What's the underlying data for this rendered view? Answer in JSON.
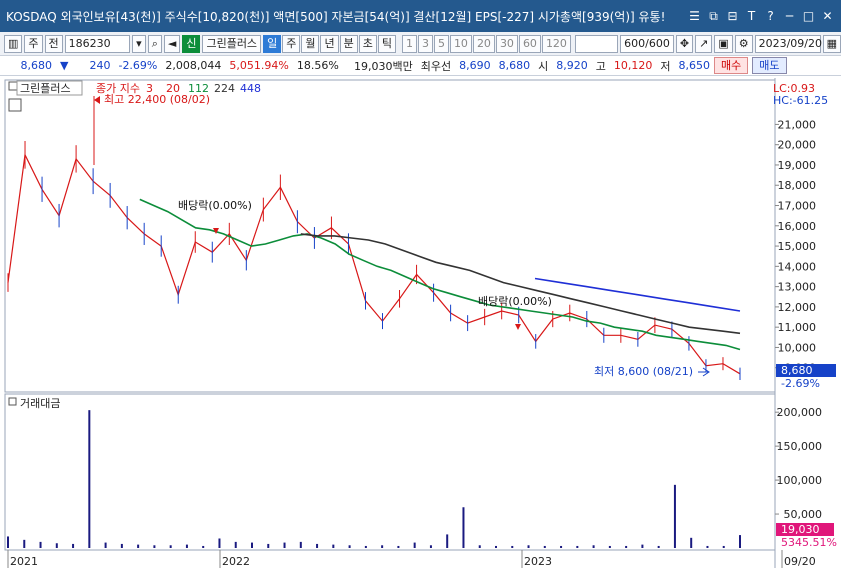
{
  "titlebar": {
    "title": "KOSDAQ 외국인보유[43(천)] 주식수[10,820(천)] 액면[500] 자본금[54(억)] 결산[12월] EPS[-227] 시가총액[939(억)] 유통!",
    "icons": [
      "list-icon",
      "restore-icon",
      "pin-icon",
      "text-size-icon",
      "help-icon",
      "minimize-icon",
      "maximize-icon",
      "close-icon"
    ]
  },
  "toolbar": {
    "period_select": "주",
    "prefix": "전",
    "code": "186230",
    "signal_label": "신",
    "stock_name": "그린플러스",
    "period_tabs": [
      "일",
      "주",
      "월",
      "년",
      "분",
      "초",
      "틱"
    ],
    "active_tab": "일",
    "intervals": [
      "1",
      "3",
      "5",
      "10",
      "20",
      "30",
      "60",
      "120"
    ],
    "count": "600/600",
    "date": "2023/09/20"
  },
  "infobar": {
    "price": "8,680",
    "change": "240",
    "change_pct": "-2.69%",
    "volume": "2,008,044",
    "volume_pct": "5,051.94%",
    "turnover": "18.56%",
    "amount": "19,030백만",
    "best_ask_label": "최우선",
    "best_ask": "8,690",
    "best_bid": "8,680",
    "open_label": "시",
    "open": "8,920",
    "high_label": "고",
    "high": "10,120",
    "low_label": "저",
    "low": "8,650",
    "buy_label": "매수",
    "sell_label": "매도"
  },
  "price_panel": {
    "stock_label": "그린플러스",
    "legend_prefix": "종가 지수",
    "ma_periods": [
      "3",
      "20",
      "112",
      "224",
      "448"
    ],
    "lc": "LC:0.93",
    "hc": "HC:-61.25",
    "high_note": "최고 22,400 (08/02)",
    "low_note": "최저 8,600 (08/21)",
    "dividend_label_1": "배당락(0.00%)",
    "dividend_label_2": "배당락(0.00%)",
    "current_price": "8,680",
    "current_pct": "-2.69%"
  },
  "volume_panel": {
    "label": "거래대금",
    "current_value": "19,030",
    "current_pct": "5345.51%"
  },
  "colors": {
    "price_line": "#d81818",
    "candle_down": "#1642c8",
    "ma20": "#d81818",
    "ma112": "#0c8d3a",
    "ma224": "#333333",
    "ma448": "#1f2fd6",
    "volume_bar": "#1a1a80"
  },
  "chart_data": [
    {
      "type": "line",
      "x_labels": [
        "2021",
        "2022",
        "2023",
        "09/20"
      ],
      "y_ticks": [
        "21,000",
        "20,000",
        "19,000",
        "18,000",
        "17,000",
        "16,000",
        "15,000",
        "14,000",
        "13,000",
        "12,000",
        "11,000",
        "10,000",
        "9,000"
      ],
      "ylim": [
        8000,
        22500
      ],
      "series": [
        {
          "name": "종가",
          "values": [
            13200,
            19500,
            17800,
            16500,
            19300,
            18200,
            17500,
            16400,
            15600,
            15000,
            12600,
            15200,
            14700,
            15600,
            14300,
            16800,
            17900,
            16200,
            15400,
            15900,
            15100,
            12300,
            11300,
            12400,
            13600,
            12700,
            11700,
            11200,
            11500,
            11800,
            11600,
            10300,
            11400,
            11700,
            11400,
            10600,
            10600,
            10400,
            11100,
            10900,
            10200,
            9100,
            9200,
            8700
          ]
        },
        {
          "name": "112",
          "values": [
            17300,
            17000,
            16700,
            16300,
            15900,
            15800,
            15600,
            15300,
            15000,
            15100,
            15300,
            15500,
            15600,
            15400,
            15100,
            14600,
            14300,
            14000,
            13800,
            13500,
            13200,
            12900,
            12700,
            12500,
            12300,
            12100,
            12000,
            11900,
            11800,
            11700,
            11600,
            11500,
            11300,
            11200,
            11000,
            10900,
            10800,
            10600,
            10500,
            10400,
            10300,
            10200,
            10100,
            9900
          ]
        },
        {
          "name": "224",
          "values": [
            15600,
            15500,
            15500,
            15400,
            15300,
            15100,
            14800,
            14500,
            14200,
            14000,
            13800,
            13500,
            13200,
            13000,
            12800,
            12600,
            12400,
            12200,
            12000,
            11800,
            11600,
            11400,
            11200,
            11000,
            10900,
            10800,
            10700
          ]
        },
        {
          "name": "448",
          "values": [
            13400,
            13200,
            13000,
            12800,
            12600,
            12400,
            12200,
            12000,
            11800
          ]
        }
      ]
    },
    {
      "type": "bar",
      "title": "거래대금",
      "y_ticks": [
        "200,000",
        "150,000",
        "100,000",
        "50,000"
      ],
      "ylim": [
        0,
        215000
      ],
      "series": [
        {
          "name": "거래대금",
          "values": [
            17000,
            12000,
            9000,
            7000,
            6000,
            203000,
            8000,
            6000,
            5000,
            4000,
            4000,
            5000,
            3000,
            14000,
            9000,
            8000,
            6000,
            8000,
            9000,
            6000,
            5000,
            4000,
            3000,
            4000,
            3000,
            8000,
            4000,
            20000,
            60000,
            4000,
            3000,
            3000,
            4000,
            3000,
            3000,
            3000,
            4000,
            3000,
            3000,
            5000,
            3000,
            93000,
            15000,
            3000,
            3000,
            19030
          ]
        }
      ]
    }
  ]
}
